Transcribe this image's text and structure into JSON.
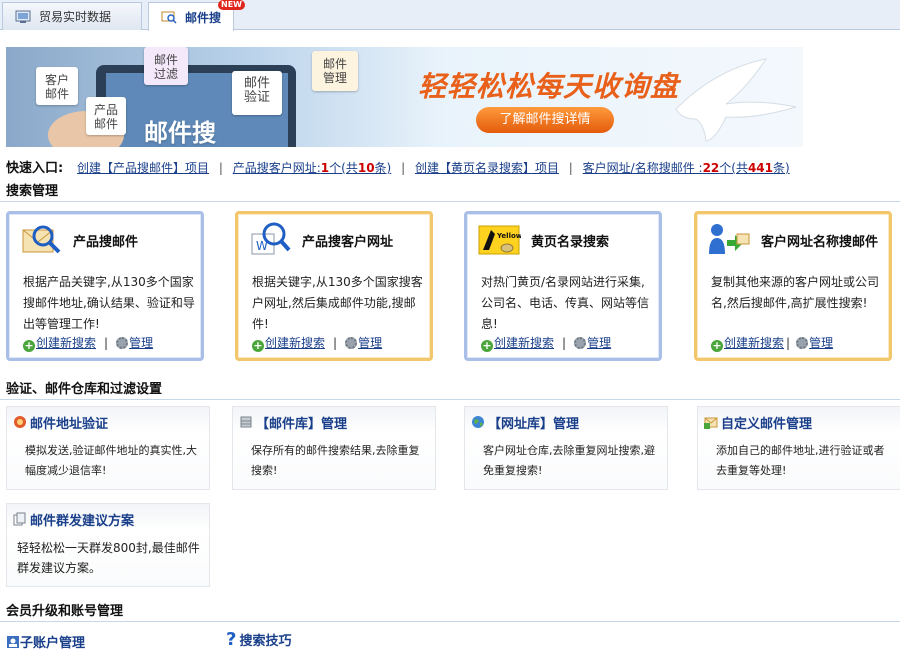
{
  "tabs": [
    {
      "label": "贸易实时数据",
      "active": false
    },
    {
      "label": "邮件搜",
      "active": true,
      "badge": "NEW"
    }
  ],
  "banner": {
    "envelopes": [
      "客户\n邮件",
      "产品\n邮件",
      "邮件\n过滤",
      "邮件\n验证",
      "邮件\n管理"
    ],
    "title": "邮件搜",
    "slogan": "轻轻松松每天收询盘",
    "button": "了解邮件搜详情"
  },
  "quick": {
    "label": "快速入口:",
    "link1": "创建【产品搜邮件】项目",
    "link2_pre": "产品搜客户网址:",
    "link2_count": "1",
    "link2_mid": "个(共",
    "link2_total": "10",
    "link2_suf": "条)",
    "link3": "创建【黄页名录搜索】项目",
    "link4_pre": "客户网址/名称搜邮件 :",
    "link4_count": "22",
    "link4_mid": "个(共",
    "link4_total": "441",
    "link4_suf": "条)"
  },
  "sections": {
    "search": "搜索管理",
    "verify": "验证、邮件仓库和过滤设置",
    "member": "会员升级和账号管理"
  },
  "cards": [
    {
      "title": "产品搜邮件",
      "desc": "根据产品关键字,从130多个国家搜邮件地址,确认结果、验证和导出等管理工作!",
      "create": "创建新搜索",
      "manage": "管理",
      "style": "blue"
    },
    {
      "title": "产品搜客户网址",
      "desc": "根据关键字,从130多个国家搜客户网址,然后集成邮件功能,搜邮件!",
      "create": "创建新搜索",
      "manage": "管理",
      "style": "gold"
    },
    {
      "title": "黄页名录搜索",
      "desc": "对热门黄页/名录网站进行采集,公司名、电话、传真、网站等信息!",
      "create": "创建新搜索",
      "manage": "管理",
      "style": "blue",
      "logo": "Yellow Page"
    },
    {
      "title": "客户网址名称搜邮件",
      "desc": "复制其他来源的客户网址或公司名,然后搜邮件,高扩展性搜索!",
      "create": "创建新搜索",
      "manage": "管理",
      "style": "gold"
    }
  ],
  "boxes": [
    {
      "title": "邮件地址验证",
      "desc": "模拟发送,验证邮件地址的真实性,大幅度减少退信率!"
    },
    {
      "title": "【邮件库】管理",
      "desc": "保存所有的邮件搜索结果,去除重复搜索!"
    },
    {
      "title": "【网址库】管理",
      "desc": "客户网址仓库,去除重复网址搜索,避免重复搜索!"
    },
    {
      "title": "自定义邮件管理",
      "desc": "添加自己的邮件地址,进行验证或者去重复等处理!"
    },
    {
      "title": "邮件群发建议方案",
      "desc": "轻轻松松一天群发800封,最佳邮件群发建议方案。"
    }
  ],
  "bottom": {
    "sub_account": "子账户管理",
    "search_tips": "搜索技巧"
  },
  "colors": {
    "link": "#1a3f8a",
    "accent": "#e8601a",
    "count_red": "#cc0000",
    "card_blue": "#a9bfe8",
    "card_gold": "#f2c66b"
  }
}
